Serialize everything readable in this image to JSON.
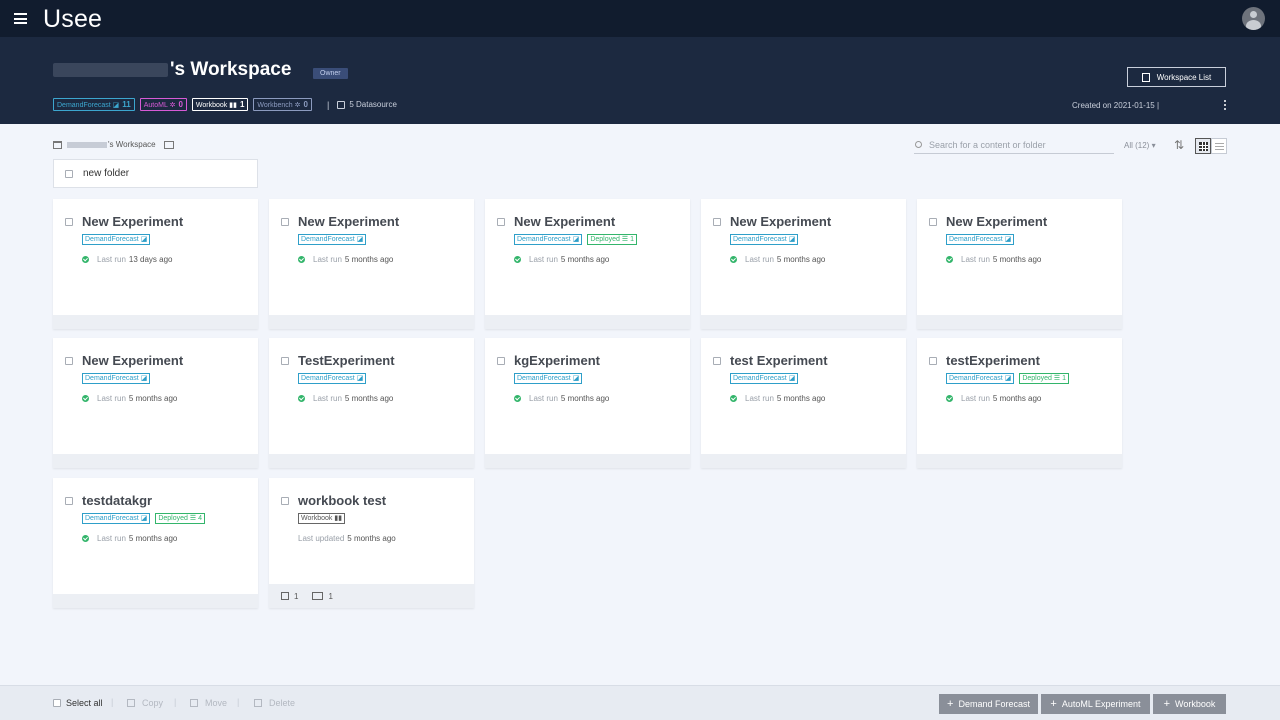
{
  "app": {
    "logo": "Usee"
  },
  "workspace": {
    "title_suffix": "'s Workspace",
    "role": "Owner",
    "counts": [
      {
        "label": "DemandForecast",
        "icon": "◪",
        "count": "11",
        "kind": "df"
      },
      {
        "label": "AutoML",
        "icon": "✲",
        "count": "0",
        "kind": "am"
      },
      {
        "label": "Workbook",
        "icon": "▮▮",
        "count": "1",
        "kind": "wbk"
      },
      {
        "label": "Workbench",
        "icon": "✲",
        "count": "0",
        "kind": "wbn"
      }
    ],
    "separator": "|",
    "datasource": "5 Datasource",
    "list_button": "Workspace List",
    "created": "Created on 2021-01-15 |"
  },
  "toolbar": {
    "breadcrumb": "'s Workspace",
    "search_placeholder": "Search for a content or folder",
    "filter": "All (12)",
    "filter_caret": "▾",
    "sort_glyph": "⇅"
  },
  "folder": {
    "name": "new folder"
  },
  "cards": [
    {
      "title": "New Experiment",
      "tags": [
        {
          "label": "DemandForecast",
          "icon": "◪",
          "kind": "df"
        }
      ],
      "prefix": "Last run",
      "when": "13 days ago"
    },
    {
      "title": "New Experiment",
      "tags": [
        {
          "label": "DemandForecast",
          "icon": "◪",
          "kind": "df"
        }
      ],
      "prefix": "Last run",
      "when": "5 months ago"
    },
    {
      "title": "New Experiment",
      "tags": [
        {
          "label": "DemandForecast",
          "icon": "◪",
          "kind": "df"
        },
        {
          "label": "Deployed",
          "icon": "☰ 1",
          "kind": "dep"
        }
      ],
      "prefix": "Last run",
      "when": "5 months ago"
    },
    {
      "title": "New Experiment",
      "tags": [
        {
          "label": "DemandForecast",
          "icon": "◪",
          "kind": "df"
        }
      ],
      "prefix": "Last run",
      "when": "5 months ago"
    },
    {
      "title": "New Experiment",
      "tags": [
        {
          "label": "DemandForecast",
          "icon": "◪",
          "kind": "df"
        }
      ],
      "prefix": "Last run",
      "when": "5 months ago"
    },
    {
      "title": "New Experiment",
      "tags": [
        {
          "label": "DemandForecast",
          "icon": "◪",
          "kind": "df"
        }
      ],
      "prefix": "Last run",
      "when": "5 months ago"
    },
    {
      "title": "TestExperiment",
      "tags": [
        {
          "label": "DemandForecast",
          "icon": "◪",
          "kind": "df"
        }
      ],
      "prefix": "Last run",
      "when": "5 months ago"
    },
    {
      "title": "kgExperiment",
      "tags": [
        {
          "label": "DemandForecast",
          "icon": "◪",
          "kind": "df"
        }
      ],
      "prefix": "Last run",
      "when": "5 months ago"
    },
    {
      "title": "test Experiment",
      "tags": [
        {
          "label": "DemandForecast",
          "icon": "◪",
          "kind": "df"
        }
      ],
      "prefix": "Last run",
      "when": "5 months ago"
    },
    {
      "title": "testExperiment",
      "tags": [
        {
          "label": "DemandForecast",
          "icon": "◪",
          "kind": "df"
        },
        {
          "label": "Deployed",
          "icon": "☰ 1",
          "kind": "dep"
        }
      ],
      "prefix": "Last run",
      "when": "5 months ago"
    },
    {
      "title": "testdatakgr",
      "tags": [
        {
          "label": "DemandForecast",
          "icon": "◪",
          "kind": "df"
        },
        {
          "label": "Deployed",
          "icon": "☰ 4",
          "kind": "dep"
        }
      ],
      "prefix": "Last run",
      "when": "5 months ago"
    },
    {
      "title": "workbook test",
      "tags": [
        {
          "label": "Workbook",
          "icon": "▮▮",
          "kind": "wb"
        }
      ],
      "prefix": "Last updated",
      "when": "5 months ago",
      "workbook": true,
      "footer": [
        "1",
        "1"
      ]
    }
  ],
  "bottom": {
    "select_all": "Select all",
    "actions": [
      "Copy",
      "Move",
      "Delete"
    ],
    "create": [
      "Demand Forecast",
      "AutoML Experiment",
      "Workbook"
    ],
    "plus": "+"
  },
  "colors": {
    "topbar": "#111c2e",
    "header": "#1c2940",
    "demand_forecast": "#2e9fc9",
    "deployed": "#33b56b",
    "automl": "#d75ad6"
  }
}
